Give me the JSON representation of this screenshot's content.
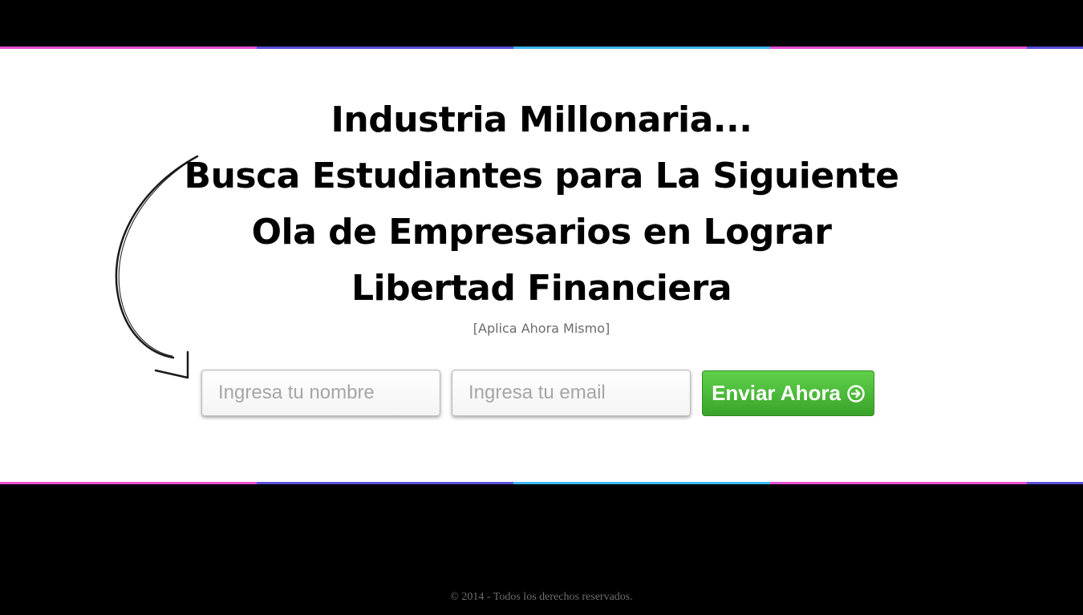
{
  "headline": {
    "line1": "Industria Millonaria...",
    "line2": "Busca Estudiantes para La Siguiente",
    "line3": "Ola de Empresarios en Lograr",
    "line4": "Libertad Financiera"
  },
  "subline": "[Aplica Ahora Mismo]",
  "form": {
    "name_placeholder": "Ingresa tu nombre",
    "email_placeholder": "Ingresa tu email",
    "submit_label": "Enviar Ahora",
    "submit_icon": "circle-arrow-right-icon"
  },
  "footer": {
    "copyright": "© 2014 - Todos los derechos reservados."
  },
  "colors": {
    "background": "#000000",
    "panel": "#ffffff",
    "button": "#4cbb38",
    "stripe_pink": "#e74fd1",
    "stripe_blue": "#5a4fd6",
    "stripe_cyan": "#3db7ef"
  }
}
